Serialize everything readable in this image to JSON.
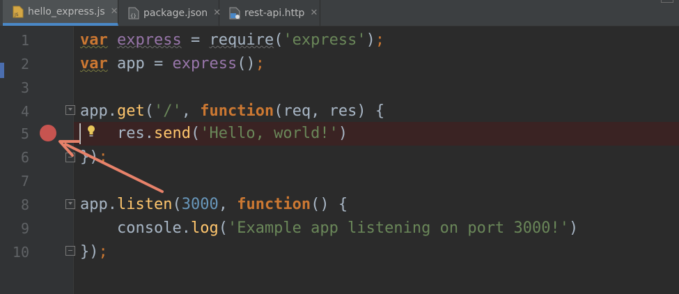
{
  "tabs": [
    {
      "label": "hello_express.js",
      "icon": "js-file-icon",
      "active": true
    },
    {
      "label": "package.json",
      "icon": "json-file-icon",
      "active": false
    },
    {
      "label": "rest-api.http",
      "icon": "http-file-icon",
      "active": false
    }
  ],
  "tab_close_glyph": "✕",
  "line_numbers": [
    "1",
    "2",
    "3",
    "4",
    "5",
    "6",
    "7",
    "8",
    "9",
    "10"
  ],
  "code": {
    "l1": {
      "kw": "var",
      "name": "express",
      "eq": " = ",
      "call": "require",
      "open": "(",
      "str": "'express'",
      "close": ")",
      "semi": ";"
    },
    "l2": {
      "kw": "var",
      "name": " app = ",
      "call": "express",
      "parens": "()",
      "semi": ";"
    },
    "l4": {
      "obj": "app.",
      "method": "get",
      "open": "(",
      "str": "'/'",
      "comma": ", ",
      "kw": "function",
      "params": "(req, res) {"
    },
    "l5": {
      "indent": "    ",
      "obj": "res.",
      "method": "send",
      "open": "(",
      "str": "'Hello, world!'",
      "close": ")"
    },
    "l6": {
      "close": "})",
      "semi": ";"
    },
    "l8": {
      "obj": "app.",
      "method": "listen",
      "open": "(",
      "num": "3000",
      "comma": ", ",
      "kw": "function",
      "params": "() {"
    },
    "l9": {
      "indent": "    ",
      "obj": "console.",
      "method": "log",
      "open": "(",
      "str": "'Example app listening on port 3000!'",
      "close": ")"
    },
    "l10": {
      "close": "})",
      "semi": ";"
    }
  },
  "breakpoint_line": 5,
  "colors": {
    "editor_bg": "#2b2b2b",
    "keyword": "#cc7832",
    "string": "#6a8759",
    "number": "#6897bb",
    "function": "#ffc66d",
    "variable": "#9876aa",
    "breakpoint": "#c75450",
    "annotation_arrow": "#e8826a"
  }
}
